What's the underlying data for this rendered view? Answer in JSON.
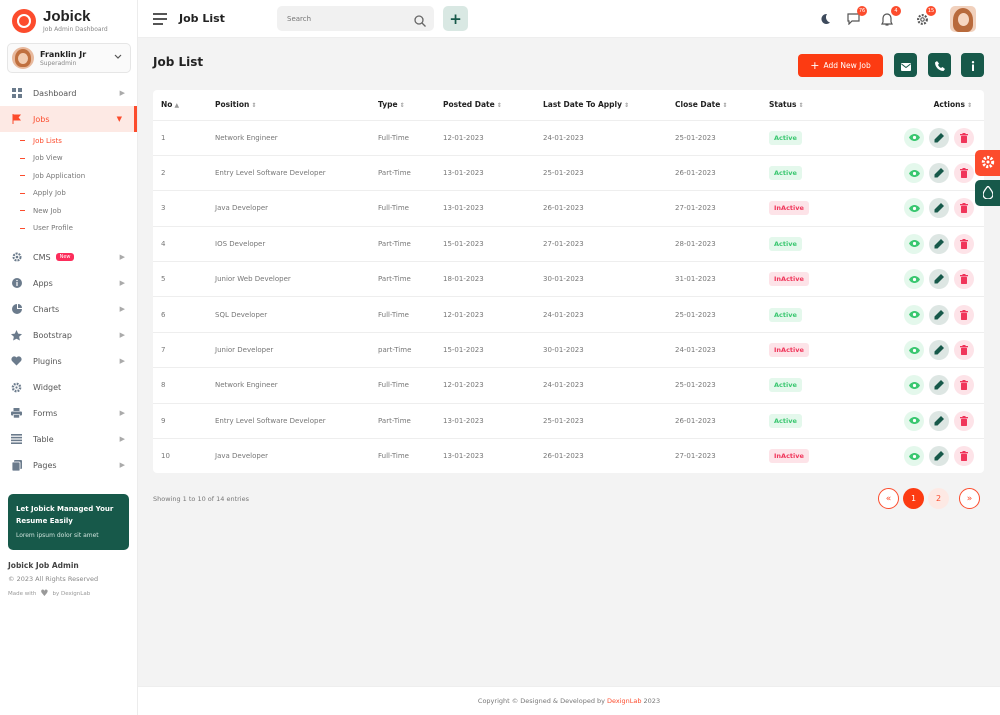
{
  "brand": {
    "name": "Jobick",
    "subtitle": "Job Admin Dashboard"
  },
  "user": {
    "name": "Franklin Jr",
    "role": "Superadmin"
  },
  "sidebar": {
    "items": [
      {
        "label": "Dashboard",
        "icon": "grid-icon"
      },
      {
        "label": "Jobs",
        "icon": "flag-icon",
        "active": true
      },
      {
        "label": "CMS",
        "icon": "gear-icon",
        "badge": "New"
      },
      {
        "label": "Apps",
        "icon": "info-icon"
      },
      {
        "label": "Charts",
        "icon": "chart-icon"
      },
      {
        "label": "Bootstrap",
        "icon": "star-icon"
      },
      {
        "label": "Plugins",
        "icon": "heart-icon"
      },
      {
        "label": "Widget",
        "icon": "settings-icon"
      },
      {
        "label": "Forms",
        "icon": "printer-icon"
      },
      {
        "label": "Table",
        "icon": "list-icon"
      },
      {
        "label": "Pages",
        "icon": "pages-icon"
      }
    ],
    "subitems": [
      "Job Lists",
      "Job View",
      "Job Application",
      "Apply Job",
      "New Job",
      "User Profile"
    ],
    "promo": {
      "title": "Let Jobick Managed Your Resume Easily",
      "text": "Lorem ipsum dolor sit amet"
    },
    "footer": {
      "title": "Jobick Job Admin",
      "copy": "© 2023 All Rights Reserved",
      "made_prefix": "Made with",
      "made_suffix": "by DexignLab"
    }
  },
  "header": {
    "title": "Job List",
    "search_placeholder": "Search",
    "messages_count": "76",
    "notifications_count": "4",
    "settings_count": "15"
  },
  "main": {
    "title": "Job List",
    "add_button": "Add New Job",
    "columns": [
      "No",
      "Position",
      "Type",
      "Posted Date",
      "Last Date To Apply",
      "Close Date",
      "Status",
      "Actions"
    ],
    "rows": [
      {
        "no": "1",
        "position": "Network Engineer",
        "type": "Full-Time",
        "posted": "12-01-2023",
        "last": "24-01-2023",
        "close": "25-01-2023",
        "status": "Active"
      },
      {
        "no": "2",
        "position": "Entry Level Software Developer",
        "type": "Part-Time",
        "posted": "13-01-2023",
        "last": "25-01-2023",
        "close": "26-01-2023",
        "status": "Active"
      },
      {
        "no": "3",
        "position": "Java Developer",
        "type": "Full-Time",
        "posted": "13-01-2023",
        "last": "26-01-2023",
        "close": "27-01-2023",
        "status": "InActive"
      },
      {
        "no": "4",
        "position": "IOS Developer",
        "type": "Part-Time",
        "posted": "15-01-2023",
        "last": "27-01-2023",
        "close": "28-01-2023",
        "status": "Active"
      },
      {
        "no": "5",
        "position": "Junior Web Developer",
        "type": "Part-Time",
        "posted": "18-01-2023",
        "last": "30-01-2023",
        "close": "31-01-2023",
        "status": "InActive"
      },
      {
        "no": "6",
        "position": "SQL Developer",
        "type": "Full-Time",
        "posted": "12-01-2023",
        "last": "24-01-2023",
        "close": "25-01-2023",
        "status": "Active"
      },
      {
        "no": "7",
        "position": "Junior Developer",
        "type": "part-Time",
        "posted": "15-01-2023",
        "last": "30-01-2023",
        "close": "24-01-2023",
        "status": "InActive"
      },
      {
        "no": "8",
        "position": "Network Engineer",
        "type": "Full-Time",
        "posted": "12-01-2023",
        "last": "24-01-2023",
        "close": "25-01-2023",
        "status": "Active"
      },
      {
        "no": "9",
        "position": "Entry Level Software Developer",
        "type": "Part-Time",
        "posted": "13-01-2023",
        "last": "25-01-2023",
        "close": "26-01-2023",
        "status": "Active"
      },
      {
        "no": "10",
        "position": "Java Developer",
        "type": "Full-Time",
        "posted": "13-01-2023",
        "last": "26-01-2023",
        "close": "27-01-2023",
        "status": "InActive"
      }
    ],
    "showing": "Showing 1 to 10 of 14 entries",
    "pages": [
      "1",
      "2"
    ],
    "prev_label": "«",
    "next_label": "»"
  },
  "footer": {
    "prefix": "Copyright © Designed & Developed by",
    "brand": "DexignLab",
    "year": "2023"
  },
  "colors": {
    "accent": "#fc4c2d",
    "dark_green": "#17594a",
    "active_green": "#3ac770",
    "inactive_red": "#f0355a"
  }
}
